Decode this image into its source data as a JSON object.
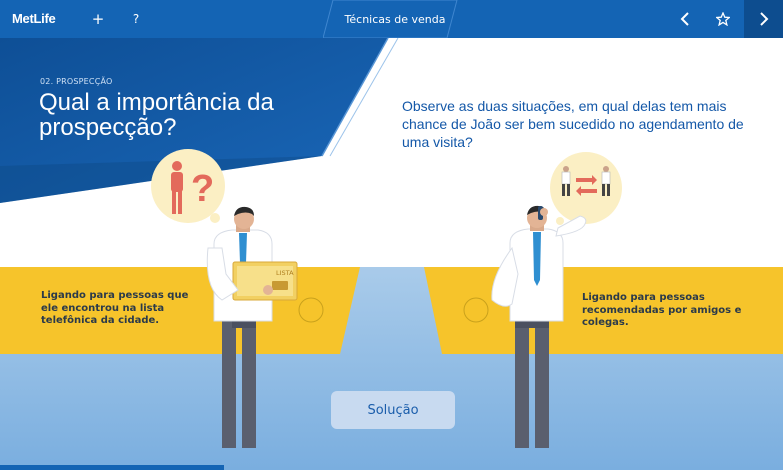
{
  "header": {
    "logo": "MetLife",
    "add_label": "+",
    "help_label": "?",
    "title": "Técnicas de venda",
    "prev_icon": "chevron-left-icon",
    "favorite_icon": "star-outline-icon",
    "next_icon": "chevron-right-icon"
  },
  "content": {
    "section_label": "02. PROSPECÇÃO",
    "heading": "Qual a importância da prospecção?",
    "question": "Observe as duas situações, em qual delas tem mais chance de João ser bem sucedido no agendamento de uma visita?",
    "left_option": "Ligando para pessoas que ele encontrou na lista telefônica da cidade.",
    "right_option": "Ligando para pessoas recomendadas por amigos e colegas.",
    "list_label": "LISTA",
    "solution_button": "Solução"
  },
  "colors": {
    "brand_blue": "#1464b4",
    "dark_blue": "#0d4d8f",
    "yellow": "#f6c42b",
    "sky": "#a9cbea"
  }
}
